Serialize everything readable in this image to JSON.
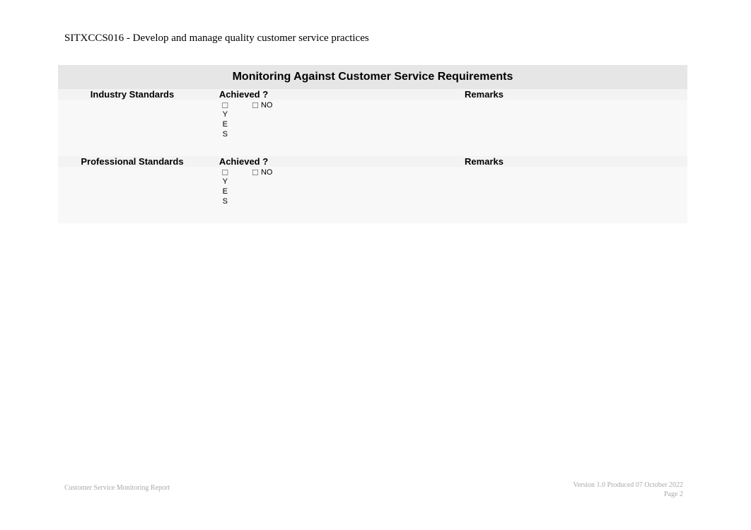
{
  "doc": {
    "course_title": "SITXCCS016 - Develop and manage quality customer service practices",
    "table_title": "Monitoring Against Customer Service Requirements",
    "headers": {
      "industry": "Industry Standards",
      "professional": "Professional Standards",
      "achieved": "Achieved ?",
      "remarks": "Remarks"
    },
    "options": {
      "yes_char1": "Y",
      "yes_char2": "E",
      "yes_char3": "S",
      "no": "NO",
      "checkbox": "☐"
    },
    "footer": {
      "left": "Customer Service Monitoring Report",
      "right1": "Version 1.0 Produced 07 October 2022",
      "right2": "Page 2"
    }
  }
}
